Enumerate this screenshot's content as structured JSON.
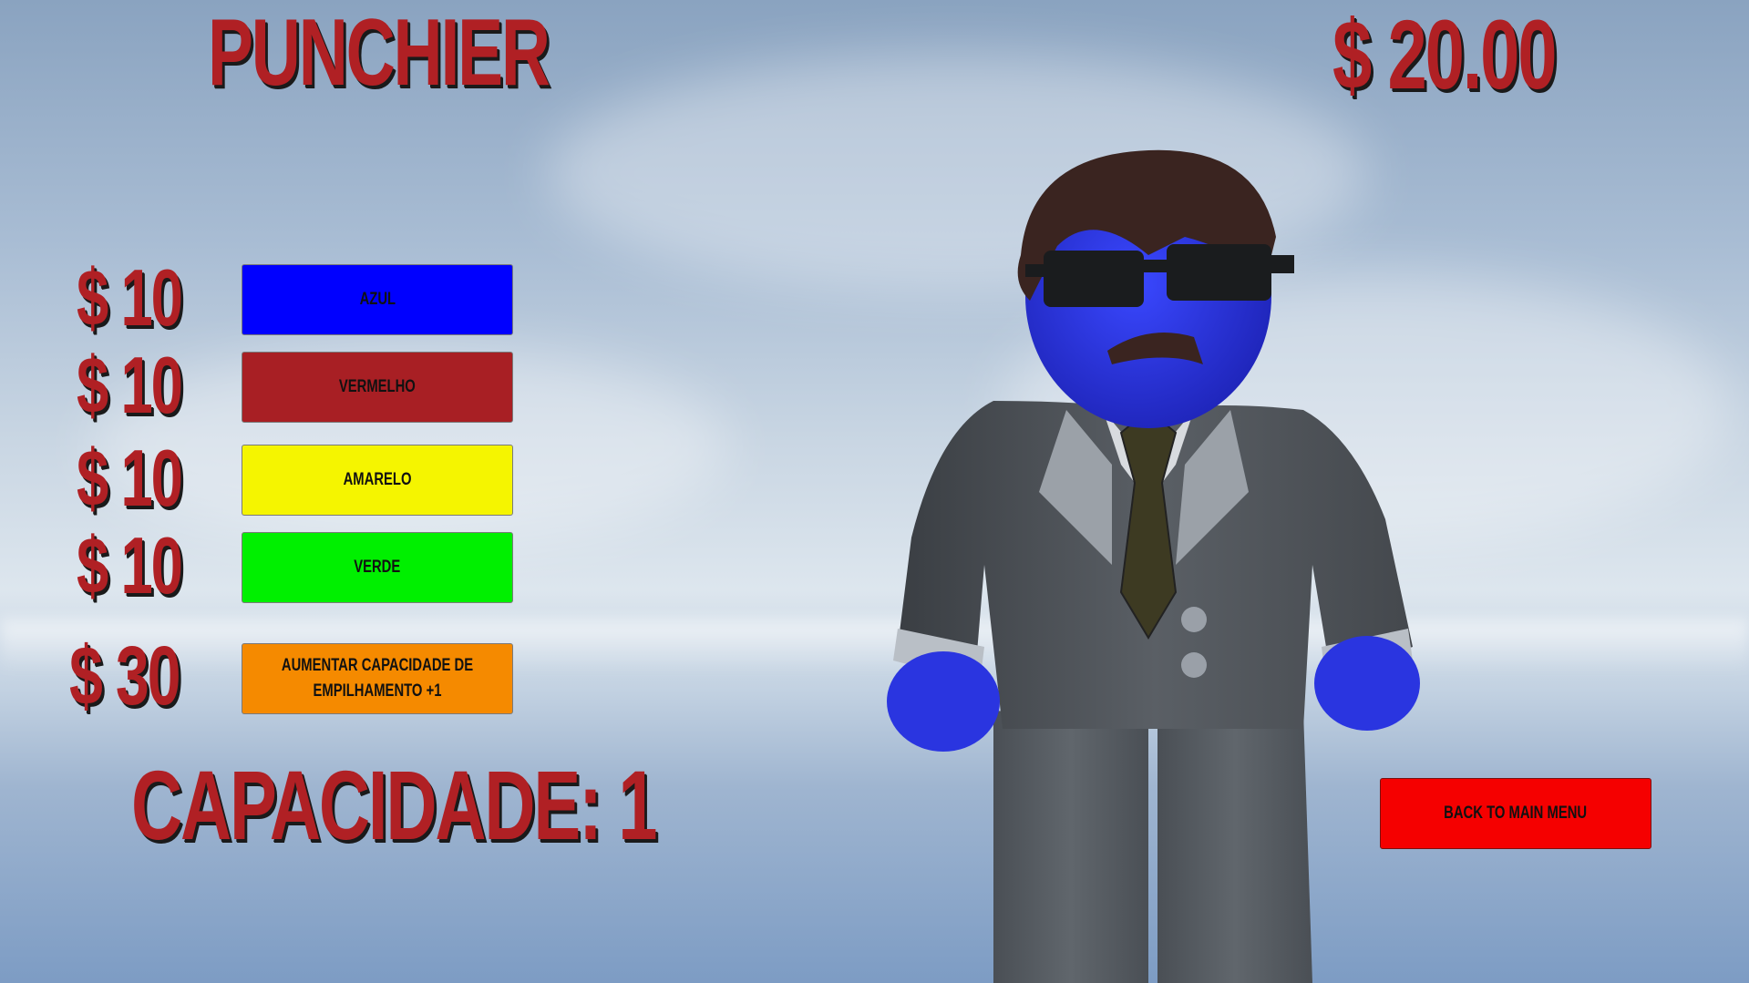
{
  "header": {
    "title": "PUNCHIER",
    "balance": "$ 20.00"
  },
  "shop": {
    "items": [
      {
        "price": "$ 10",
        "label": "AZUL",
        "color": "#0000ff"
      },
      {
        "price": "$ 10",
        "label": "VERMELHO",
        "color": "#a81f24"
      },
      {
        "price": "$ 10",
        "label": "AMARELO",
        "color": "#f5f500"
      },
      {
        "price": "$ 10",
        "label": "VERDE",
        "color": "#00f000"
      }
    ],
    "upgrade": {
      "price": "$ 30",
      "label": "AUMENTAR CAPACIDADE DE EMPILHAMENTO +1",
      "color": "#f58a00"
    }
  },
  "capacity": "CAPACIDADE: 1",
  "menu": {
    "back_label": "BACK TO MAIN MENU",
    "color": "#f50000"
  },
  "character": {
    "skin_color": "#2a35e0",
    "suit_color": "#4d5257",
    "tie_color": "#3d3a22",
    "hair_color": "#3a2420"
  }
}
